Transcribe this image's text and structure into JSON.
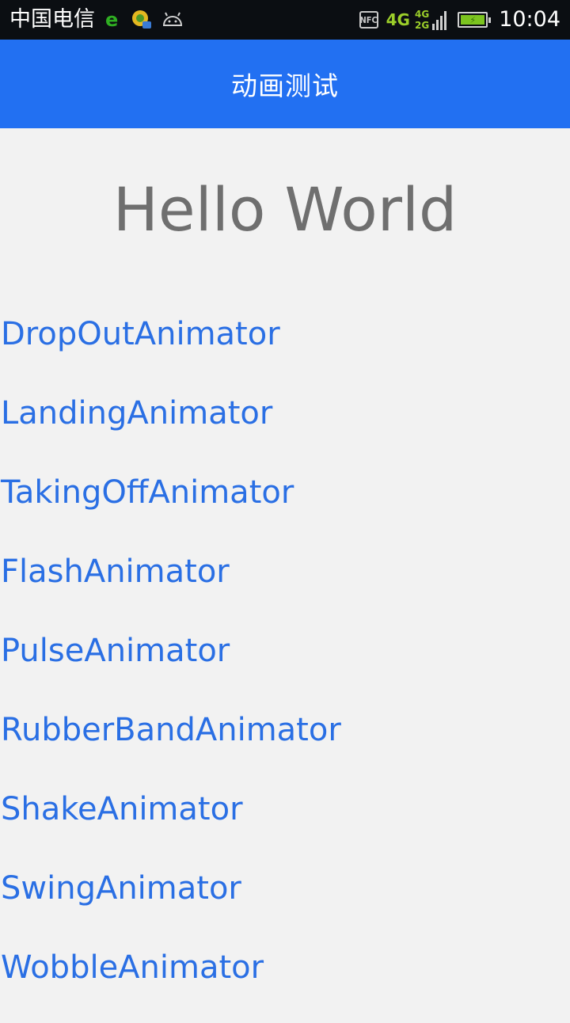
{
  "status_bar": {
    "carrier": "中国电信",
    "icons": [
      "ie-browser-icon",
      "app-notification-icon",
      "android-debug-icon"
    ],
    "nfc_label": "NFC",
    "network_main": "4G",
    "network_top": "4G",
    "network_bottom": "2G",
    "time": "10:04",
    "colors": {
      "background": "#0b0e12",
      "network": "#9ccf2a",
      "battery": "#7cc41f"
    }
  },
  "action_bar": {
    "title": "动画测试",
    "color": "#2270f2"
  },
  "content": {
    "hello": "Hello World",
    "animators": [
      "DropOutAnimator",
      "LandingAnimator",
      "TakingOffAnimator",
      "FlashAnimator",
      "PulseAnimator",
      "RubberBandAnimator",
      "ShakeAnimator",
      "SwingAnimator",
      "WobbleAnimator"
    ],
    "link_color": "#2a6fe4"
  }
}
